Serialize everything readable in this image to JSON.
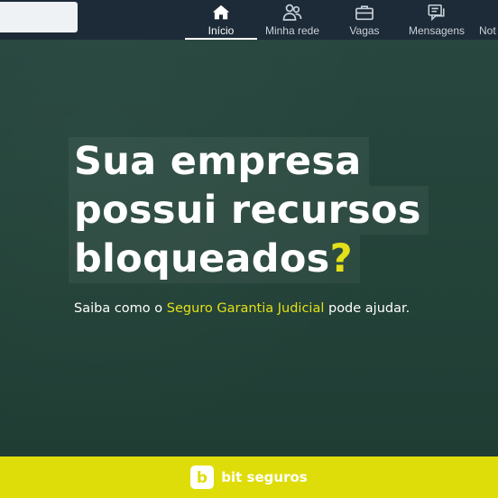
{
  "topnav": {
    "items": [
      {
        "label": "Início",
        "icon": "home-icon",
        "active": true
      },
      {
        "label": "Minha rede",
        "icon": "network-icon",
        "active": false
      },
      {
        "label": "Vagas",
        "icon": "briefcase-icon",
        "active": false
      },
      {
        "label": "Mensagens",
        "icon": "messaging-icon",
        "active": false
      },
      {
        "label": "Not",
        "icon": "bell-icon",
        "active": false
      }
    ]
  },
  "ad": {
    "headline": [
      "Sua empresa",
      "possui recursos",
      "bloqueados"
    ],
    "headline_mark": "?",
    "sub_prefix": "Saiba como o ",
    "sub_highlight": "Seguro Garantia Judicial",
    "sub_suffix": " pode ajudar.",
    "brand_name": "bit seguros",
    "brand_logo_letter": "b",
    "colors": {
      "accent": "#e3e01a",
      "footer": "#dedd0a",
      "background": "#234238",
      "nav": "#1d2b38"
    }
  }
}
